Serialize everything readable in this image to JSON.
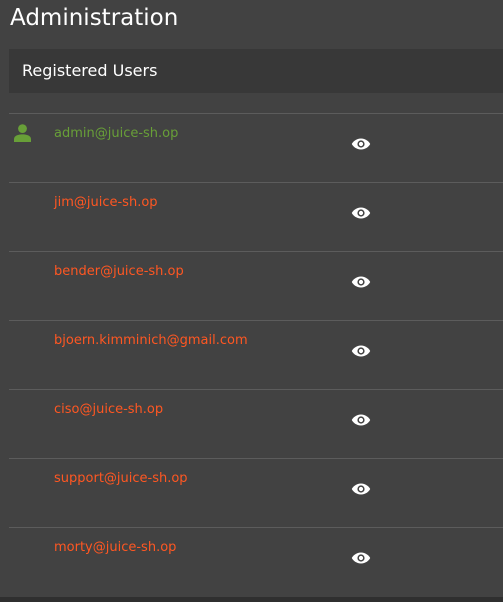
{
  "page": {
    "title": "Administration"
  },
  "registered_users": {
    "title": "Registered Users",
    "users": [
      {
        "email": "admin@juice-sh.op",
        "role_icon": "user-icon",
        "highlight_color": "#689f38"
      },
      {
        "email": "jim@juice-sh.op"
      },
      {
        "email": "bender@juice-sh.op"
      },
      {
        "email": "bjoern.kimminich@gmail.com"
      },
      {
        "email": "ciso@juice-sh.op"
      },
      {
        "email": "support@juice-sh.op"
      },
      {
        "email": "morty@juice-sh.op"
      }
    ],
    "row_action_icon": "eye-icon"
  },
  "colors": {
    "background": "#424242",
    "header_bg": "#383838",
    "email_color": "#ff5722",
    "admin_email_color": "#689f38"
  }
}
